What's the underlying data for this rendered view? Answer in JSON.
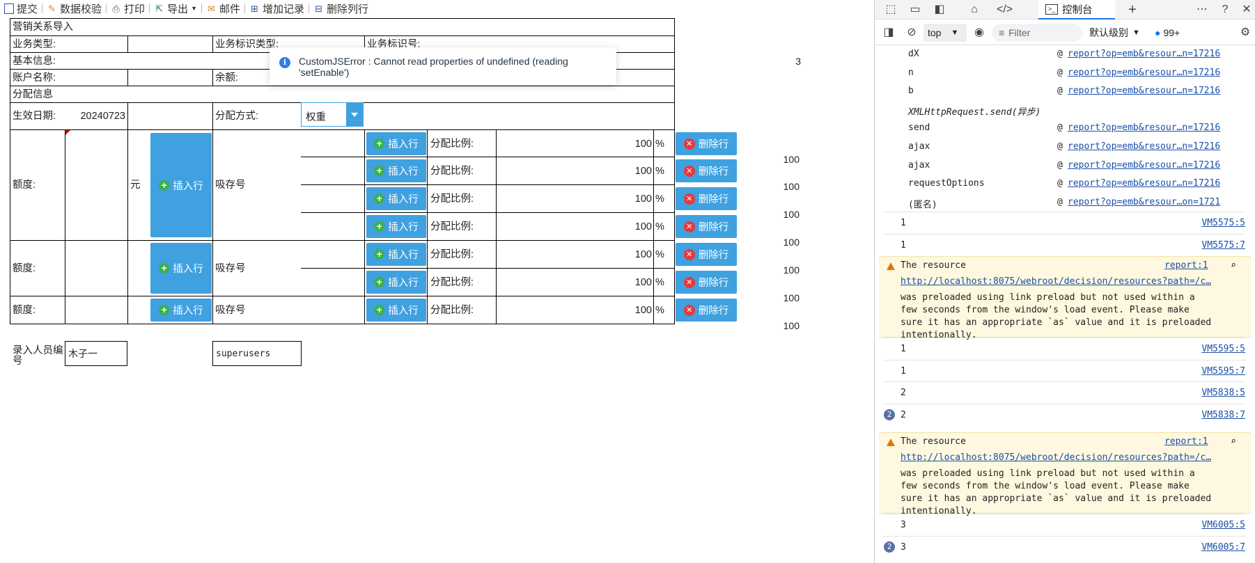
{
  "toolbar": {
    "items": [
      {
        "label": "提交",
        "icon": "submit-icon"
      },
      {
        "label": "数据校验",
        "icon": "pencil-icon"
      },
      {
        "label": "打印",
        "icon": "printer-icon"
      },
      {
        "label": "导出",
        "icon": "export-icon"
      },
      {
        "label": "邮件",
        "icon": "mail-icon"
      },
      {
        "label": "增加记录",
        "icon": "add-record-icon"
      },
      {
        "label": "删除列行",
        "icon": "delete-row-icon"
      }
    ]
  },
  "report": {
    "title": "营销关系导入",
    "biz_type_label": "业务类型:",
    "biz_id_type_label": "业务标识类型:",
    "biz_id_label": "业务标识号:",
    "side_value_top": "3",
    "basic_info": "基本信息:",
    "account_name_label": "账户名称:",
    "balance_label": "余额:",
    "alloc_info": "分配信息",
    "effective_date_label": "生效日期:",
    "effective_date_value": "20240723",
    "alloc_method_label": "分配方式:",
    "alloc_method_value": "权重",
    "quota_label": "额度:",
    "unit_yuan": "元",
    "insert_row": "插入行",
    "delete_row": "删除行",
    "deposit_no_label": "吸存号",
    "ratio_label": "分配比例:",
    "ratio_value": "100",
    "percent": "%",
    "side_value": "100",
    "entry_person_label": "录入人员编号",
    "entry_person_name": "木子一",
    "entry_person_id": "superusers"
  },
  "toast": {
    "message": "CustomJSError : Cannot read properties of undefined (reading 'setEnable')"
  },
  "devtools": {
    "tab_label": "控制台",
    "context": "top",
    "filter_placeholder": "Filter",
    "level": "默认级别",
    "badge": "99+",
    "stack": [
      {
        "fn": "dX",
        "link": "report?op=emb&resour…n=17216"
      },
      {
        "fn": "n",
        "link": "report?op=emb&resour…n=17216"
      },
      {
        "fn": "b",
        "link": "report?op=emb&resour…n=17216"
      },
      {
        "fn": "XMLHttpRequest.send(异步)",
        "link": ""
      },
      {
        "fn": "send",
        "link": "report?op=emb&resour…n=17216"
      },
      {
        "fn": "ajax",
        "link": "report?op=emb&resour…n=17216"
      },
      {
        "fn": "ajax",
        "link": "report?op=emb&resour…n=17216"
      },
      {
        "fn": "requestOptions",
        "link": "report?op=emb&resour…n=17216"
      },
      {
        "fn": "(匿名)",
        "link": "report?op=emb&resour…on=1721"
      }
    ],
    "at": "@",
    "logs_a": [
      {
        "value": "1",
        "src": "VM5575:5"
      },
      {
        "value": "1",
        "src": "VM5575:7"
      }
    ],
    "warning": {
      "title": "The resource",
      "src": "report:1",
      "url": "http://localhost:8075/webroot/decision/resources?path=/c…",
      "body": "was preloaded using link preload but not used within a\nfew seconds from the window's load event. Please make\nsure it has an appropriate `as` value and it is preloaded\nintentionally."
    },
    "logs_b": [
      {
        "value": "1",
        "src": "VM5595:5"
      },
      {
        "value": "1",
        "src": "VM5595:7"
      },
      {
        "value": "2",
        "src": "VM5838:5"
      },
      {
        "value": "2",
        "src": "VM5838:7",
        "count": "2"
      }
    ],
    "logs_c": [
      {
        "value": "3",
        "src": "VM6005:5"
      },
      {
        "value": "3",
        "src": "VM6005:7",
        "count": "2"
      }
    ]
  }
}
